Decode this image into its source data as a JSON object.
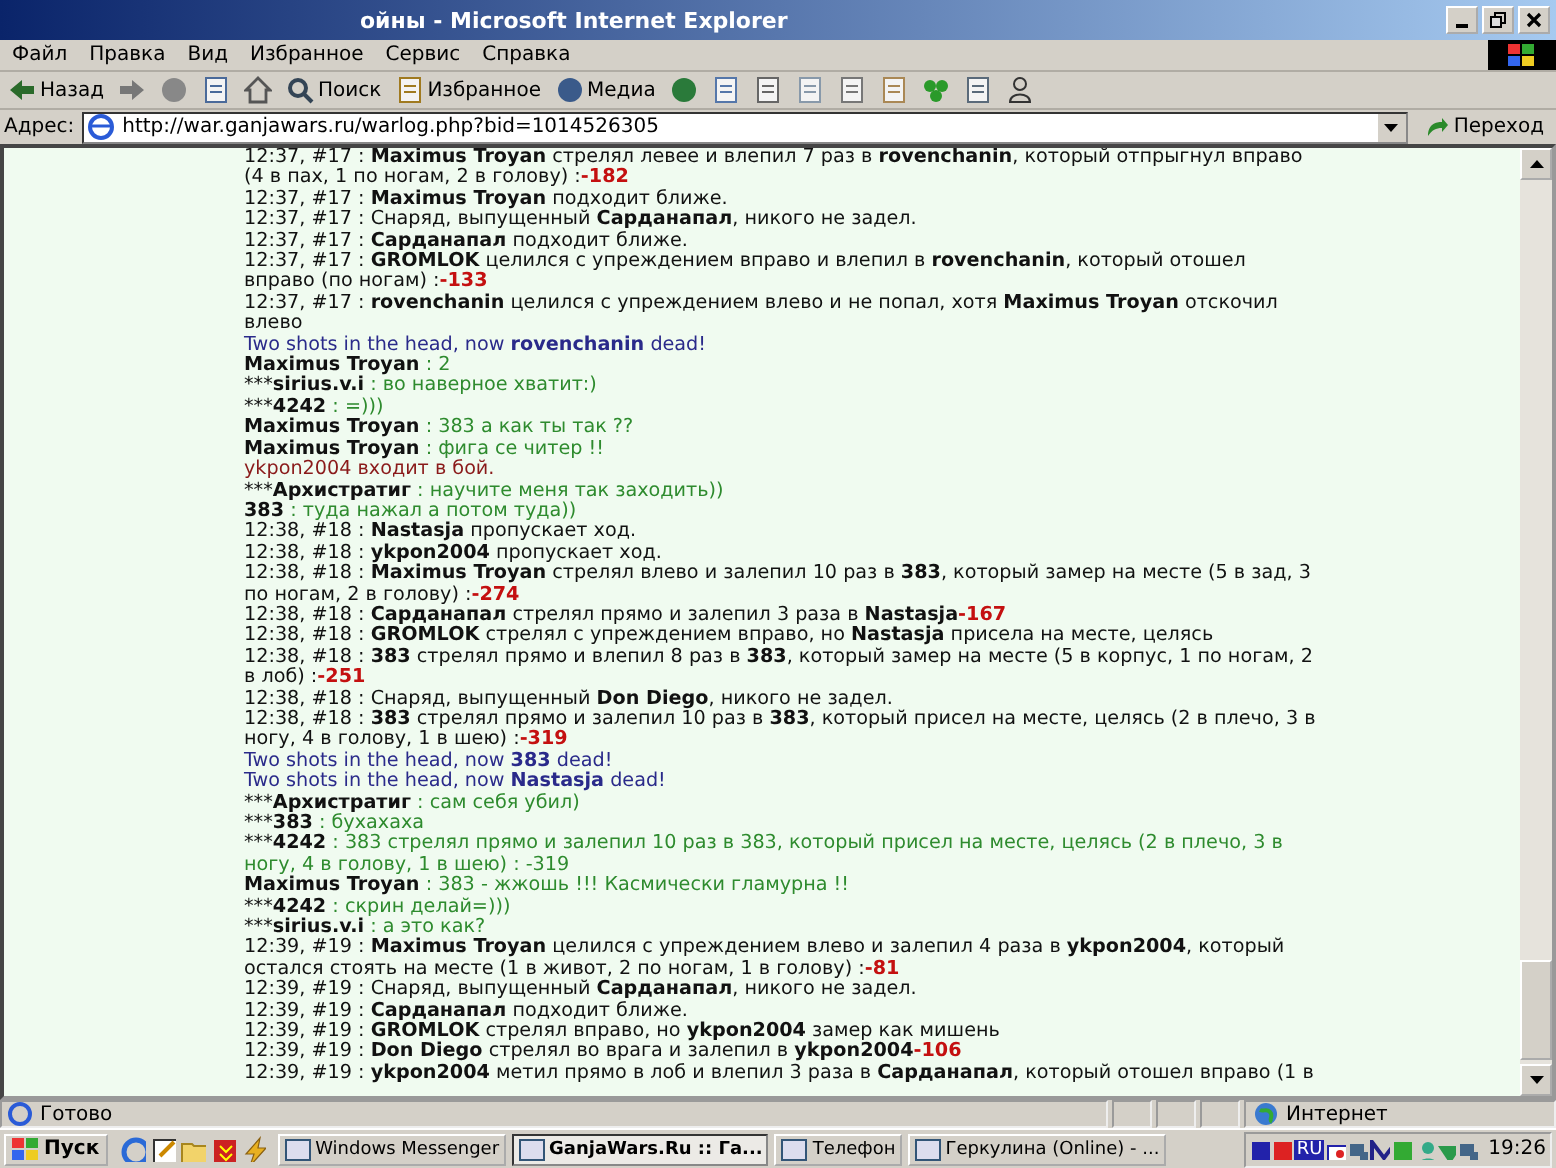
{
  "window": {
    "title": "ойны - Microsoft Internet Explorer"
  },
  "menu": [
    "Файл",
    "Правка",
    "Вид",
    "Избранное",
    "Сервис",
    "Справка"
  ],
  "toolbar": [
    {
      "kind": "back",
      "label": "Назад"
    },
    {
      "kind": "forward"
    },
    {
      "kind": "stop"
    },
    {
      "kind": "refresh"
    },
    {
      "kind": "home"
    },
    {
      "kind": "search",
      "label": "Поиск"
    },
    {
      "kind": "favorites",
      "label": "Избранное"
    },
    {
      "kind": "media",
      "label": "Медиа"
    },
    {
      "kind": "history"
    },
    {
      "kind": "mail"
    },
    {
      "kind": "print"
    },
    {
      "kind": "edit"
    },
    {
      "kind": "doc"
    },
    {
      "kind": "doc2"
    },
    {
      "kind": "clover"
    },
    {
      "kind": "book"
    },
    {
      "kind": "person"
    }
  ],
  "address": {
    "label": "Адрес:",
    "value": "http://war.ganjawars.ru/warlog.php?bid=1014526305",
    "go": "Переход"
  },
  "log": [
    {
      "kind": "event",
      "text": "12:37, #17 : **Maximus Troyan** стрелял левее и влепил 7 раз в **rovenchanin**, который отпрыгнул вправо (4 в пах, 1 по ногам, 2 в голову) :",
      "damage": "-182"
    },
    {
      "kind": "event",
      "text": "12:37, #17 : **Maximus Troyan** подходит ближе."
    },
    {
      "kind": "event",
      "text": "12:37, #17 : Снаряд, выпущенный **Сарданапал**, никого не задел."
    },
    {
      "kind": "event",
      "text": "12:37, #17 : **Сарданапал** подходит ближе."
    },
    {
      "kind": "event",
      "text": "12:37, #17 : **GROMLOK** целился с упреждением вправо и влепил в **rovenchanin**, который отошел вправо (по ногам) :",
      "damage": "-133"
    },
    {
      "kind": "event",
      "text": "12:37, #17 : **rovenchanin** целился с упреждением влево и не попал, хотя **Maximus Troyan** отскочил влево"
    },
    {
      "kind": "death",
      "text": "Two shots in the head, now **rovenchanin** dead!"
    },
    {
      "kind": "chat",
      "author": "Maximus Troyan",
      "message": ": 2"
    },
    {
      "kind": "chat",
      "prefix": "***",
      "author": "sirius.v.i",
      "message": ": во наверное хватит:)"
    },
    {
      "kind": "chat",
      "prefix": "***",
      "author": "4242",
      "message": ": =)))"
    },
    {
      "kind": "chat",
      "author": "Maximus Troyan",
      "message": ": 383 а как ты так ??"
    },
    {
      "kind": "chat",
      "author": "Maximus Troyan",
      "message": ": фига се читер !!"
    },
    {
      "kind": "join",
      "text": "ykpon2004 входит в бой."
    },
    {
      "kind": "chat",
      "prefix": "***",
      "author": "Архистратиг",
      "message": ": научите меня так заходить))"
    },
    {
      "kind": "chat",
      "author": "383",
      "message": ": туда нажал а потом туда))"
    },
    {
      "kind": "event",
      "text": "12:38, #18 : **Nastasja** пропускает ход."
    },
    {
      "kind": "event",
      "text": "12:38, #18 : **ykpon2004** пропускает ход."
    },
    {
      "kind": "event",
      "text": "12:38, #18 : **Maximus Troyan** стрелял влево и залепил 10 раз в **383**, который замер на месте (5 в зад, 3 по ногам, 2 в голову) :",
      "damage": "-274"
    },
    {
      "kind": "event",
      "text": "12:38, #18 : **Сарданапал** стрелял прямо и залепил 3 раза в **Nastasja**",
      "damage": "-167"
    },
    {
      "kind": "event",
      "text": "12:38, #18 : **GROMLOK** стрелял с упреждением вправо, но **Nastasja** присела на месте, целясь"
    },
    {
      "kind": "event",
      "text": "12:38, #18 : **383** стрелял прямо и влепил 8 раз в **383**, который замер на месте (5 в корпус, 1 по ногам, 2 в лоб) :",
      "damage": "-251"
    },
    {
      "kind": "event",
      "text": "12:38, #18 : Снаряд, выпущенный **Don Diego**, никого не задел."
    },
    {
      "kind": "event",
      "text": "12:38, #18 : **383** стрелял прямо и залепил 10 раз в **383**, который присел на месте, целясь (2 в плечо, 3 в ногу, 4 в голову, 1 в шею) :",
      "damage": "-319"
    },
    {
      "kind": "death",
      "text": "Two shots in the head, now **383** dead!"
    },
    {
      "kind": "death",
      "text": "Two shots in the head, now **Nastasja** dead!"
    },
    {
      "kind": "chat",
      "prefix": "***",
      "author": "Архистратиг",
      "message": ": сам себя убил)"
    },
    {
      "kind": "chat",
      "prefix": "***",
      "author": "383",
      "message": ": бухахаха"
    },
    {
      "kind": "chat",
      "prefix": "***",
      "author": "4242",
      "message": ": 383 стрелял прямо и залепил 10 раз в 383, который присел на месте, целясь (2 в плечо, 3 в ногу, 4 в голову, 1 в шею) : -319"
    },
    {
      "kind": "chat",
      "author": "Maximus Troyan",
      "message": ": 383 - жжошь !!! Касмически гламурна !!"
    },
    {
      "kind": "chat",
      "prefix": "***",
      "author": "4242",
      "message": ": скрин делай=)))"
    },
    {
      "kind": "chat",
      "prefix": "***",
      "author": "sirius.v.i",
      "message": ": а это как?"
    },
    {
      "kind": "event",
      "text": "12:39, #19 : **Maximus Troyan** целился с упреждением влево и залепил 4 раза в **ykpon2004**, который остался стоять на месте (1 в живот, 2 по ногам, 1 в голову) :",
      "damage": "-81"
    },
    {
      "kind": "event",
      "text": "12:39, #19 : Снаряд, выпущенный **Сарданапал**, никого не задел."
    },
    {
      "kind": "event",
      "text": "12:39, #19 : **Сарданапал** подходит ближе."
    },
    {
      "kind": "event",
      "text": "12:39, #19 : **GROMLOK** стрелял вправо, но **ykpon2004** замер как мишень"
    },
    {
      "kind": "event",
      "text": "12:39, #19 : **Don Diego** стрелял во врага и залепил в **ykpon2004**",
      "damage": "-106"
    },
    {
      "kind": "event",
      "text": "12:39, #19 : **ykpon2004** метил прямо в лоб и влепил 3 раза в **Сарданапал**, который отошел вправо (1 в"
    }
  ],
  "status_bar": {
    "text": "Готово",
    "zone": "Интернет"
  },
  "taskbar": {
    "start": "Пуск",
    "tasks": [
      {
        "label": "Windows Messenger",
        "selected": false
      },
      {
        "label": "GanjaWars.Ru :: Га...",
        "selected": true
      },
      {
        "label": "Телефон",
        "selected": false
      },
      {
        "label": "Геркулина (Online) - ...",
        "selected": false
      }
    ],
    "lang": "RU",
    "clock": "19:26"
  }
}
